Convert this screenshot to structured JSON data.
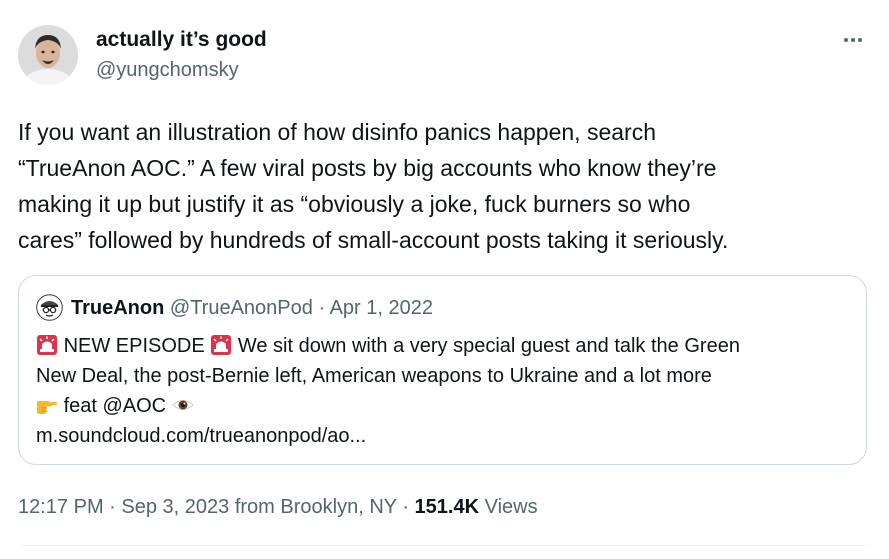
{
  "author": {
    "display_name": "actually it’s good",
    "handle": "@yungchomsky",
    "avatar_icon": "profile-photo"
  },
  "more_icon": "ellipsis-icon",
  "tweet": {
    "lines": [
      "If you want an illustration of how disinfo panics happen, search",
      "“TrueAnon AOC.” A few viral posts by big accounts who know they’re",
      "making it up but justify it as “obviously a joke, fuck burners so who",
      "cares” followed by hundreds of small-account posts taking it seriously."
    ]
  },
  "quoted": {
    "display_name": "TrueAnon",
    "handle": "@TrueAnonPod",
    "separator": "·",
    "date": "Apr 1, 2022",
    "line1_a": "NEW EPISODE",
    "line1_b": "We sit down with a very special guest and talk the Green",
    "line2": "New Deal, the post-Bernie left, American weapons to Ukraine and a lot more",
    "line3": "feat @AOC",
    "line4": "m.soundcloud.com/trueanonpod/ao...",
    "icons": [
      "siren-emoji",
      "siren-emoji",
      "pointing-hand-emoji",
      "eye-emoji"
    ]
  },
  "meta": {
    "time": "12:17 PM",
    "sep1": "·",
    "date_location": "Sep 3, 2023 from Brooklyn, NY",
    "sep2": "·",
    "views_count": "151.4K",
    "views_label": "Views"
  },
  "colors": {
    "text": "#0f1419",
    "secondary": "#536471",
    "border": "#cfd9de"
  }
}
